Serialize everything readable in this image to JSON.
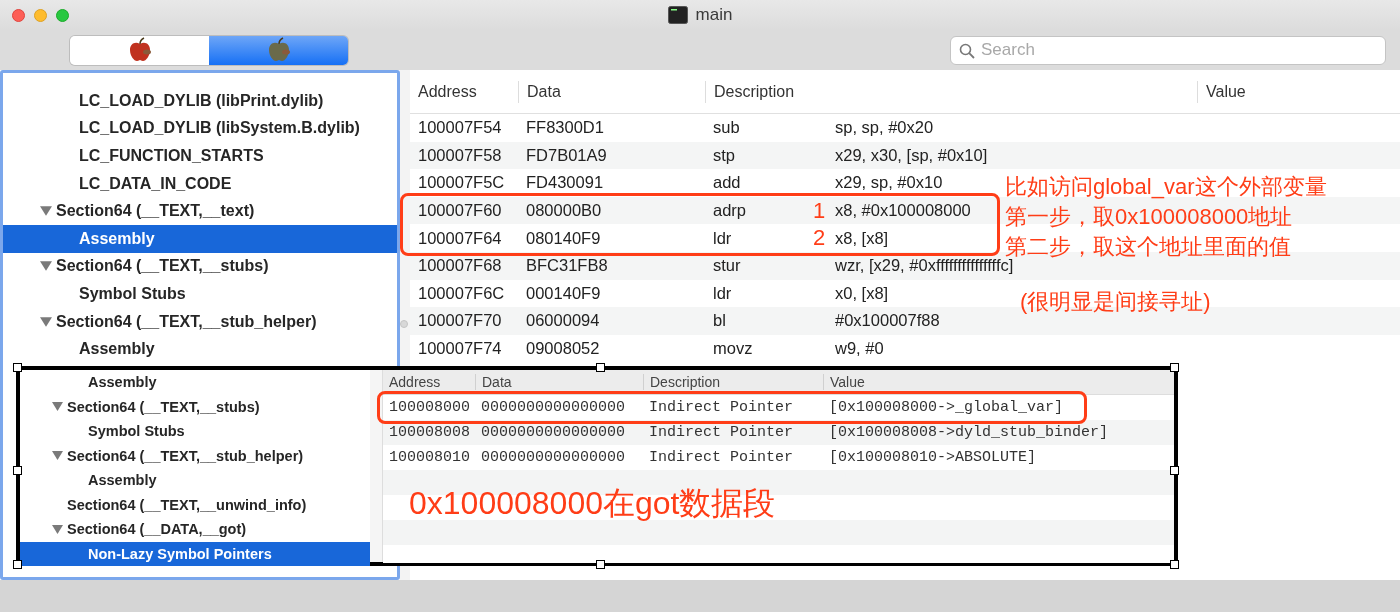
{
  "window": {
    "title": "main"
  },
  "toolbar": {
    "segments": [
      {
        "selected": false
      },
      {
        "selected": true
      }
    ],
    "search": {
      "placeholder": "Search"
    }
  },
  "sidebar": {
    "continued_children": [
      {
        "label": "LC_LOAD_DYLIB (libPrint.dylib)",
        "selected": false
      },
      {
        "label": "LC_LOAD_DYLIB (libSystem.B.dylib)",
        "selected": false
      },
      {
        "label": "LC_FUNCTION_STARTS",
        "selected": false
      },
      {
        "label": "LC_DATA_IN_CODE",
        "selected": false
      }
    ],
    "items": [
      {
        "label": "Section64 (__TEXT,__text)",
        "selected": false,
        "expanded": true,
        "children": [
          {
            "label": "Assembly",
            "selected": true
          }
        ]
      },
      {
        "label": "Section64 (__TEXT,__stubs)",
        "selected": false,
        "expanded": true,
        "children": [
          {
            "label": "Symbol Stubs",
            "selected": false
          }
        ]
      },
      {
        "label": "Section64 (__TEXT,__stub_helper)",
        "selected": false,
        "expanded": true,
        "children": [
          {
            "label": "Assembly",
            "selected": false
          }
        ]
      }
    ]
  },
  "table": {
    "columns": [
      "Address",
      "Data",
      "Description",
      "Value"
    ],
    "rows": [
      {
        "address": "100007F54",
        "data": "FF8300D1",
        "mnemonic": "sub",
        "operands": "sp, sp, #0x20",
        "highlighted": false
      },
      {
        "address": "100007F58",
        "data": "FD7B01A9",
        "mnemonic": "stp",
        "operands": "x29, x30, [sp, #0x10]",
        "highlighted": false
      },
      {
        "address": "100007F5C",
        "data": "FD430091",
        "mnemonic": "add",
        "operands": "x29, sp, #0x10",
        "highlighted": false
      },
      {
        "address": "100007F60",
        "data": "080000B0",
        "mnemonic": "adrp",
        "step": "1",
        "operands": "x8, #0x100008000",
        "highlighted": true
      },
      {
        "address": "100007F64",
        "data": "080140F9",
        "mnemonic": "ldr",
        "step": "2",
        "operands": "x8, [x8]",
        "highlighted": true
      },
      {
        "address": "100007F68",
        "data": "BFC31FB8",
        "mnemonic": "stur",
        "operands": "wzr, [x29, #0xfffffffffffffffc]",
        "highlighted": false
      },
      {
        "address": "100007F6C",
        "data": "000140F9",
        "mnemonic": "ldr",
        "operands": "x0, [x8]",
        "highlighted": false
      },
      {
        "address": "100007F70",
        "data": "06000094",
        "mnemonic": "bl",
        "operands": "#0x100007f88",
        "highlighted": false
      },
      {
        "address": "100007F74",
        "data": "09008052",
        "mnemonic": "movz",
        "operands": "w9, #0",
        "highlighted": false
      }
    ]
  },
  "annotation": {
    "notes": [
      "比如访问global_var这个外部变量",
      "第一步，取0x100008000地址",
      "第二步，取这个地址里面的值"
    ],
    "aside": "(很明显是间接寻址)"
  },
  "inset": {
    "sidebar": {
      "continued_children": [
        {
          "label": "Assembly",
          "selected": false
        }
      ],
      "items": [
        {
          "label": "Section64 (__TEXT,__stubs)",
          "selected": false,
          "expanded": true,
          "children": [
            {
              "label": "Symbol Stubs",
              "selected": false
            }
          ]
        },
        {
          "label": "Section64 (__TEXT,__stub_helper)",
          "selected": false,
          "expanded": true,
          "children": [
            {
              "label": "Assembly",
              "selected": false
            }
          ]
        },
        {
          "label": "Section64 (__TEXT,__unwind_info)",
          "selected": false
        },
        {
          "label": "Section64 (__DATA,__got)",
          "selected": false,
          "expanded": true,
          "children": [
            {
              "label": "Non-Lazy Symbol Pointers",
              "selected": true
            }
          ]
        }
      ]
    },
    "table": {
      "columns": [
        "Address",
        "Data",
        "Description",
        "Value"
      ],
      "rows": [
        {
          "address": "100008000",
          "data": "0000000000000000",
          "description": "Indirect Pointer",
          "value": "[0x100008000->_global_var]",
          "highlighted": true
        },
        {
          "address": "100008008",
          "data": "0000000000000000",
          "description": "Indirect Pointer",
          "value": "[0x100008008->dyld_stub_binder]",
          "highlighted": false
        },
        {
          "address": "100008010",
          "data": "0000000000000000",
          "description": "Indirect Pointer",
          "value": "[0x100008010->ABSOLUTE]",
          "highlighted": false
        }
      ]
    },
    "caption": "0x100008000在got数据段"
  }
}
